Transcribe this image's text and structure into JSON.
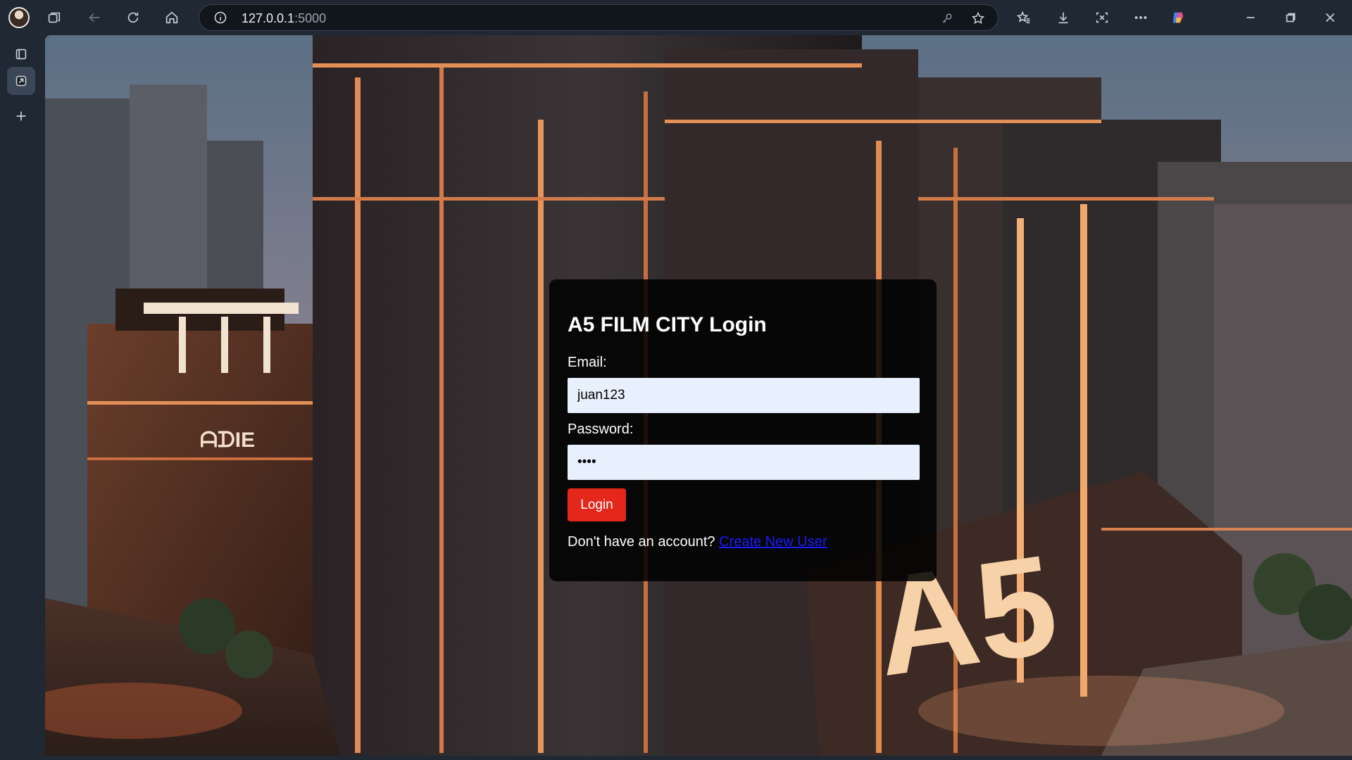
{
  "browser": {
    "url_host": "127.0.0.1",
    "url_port": ":5000",
    "icons": [
      "profile-avatar",
      "workspaces-icon",
      "back-icon",
      "refresh-icon",
      "home-icon",
      "info-icon",
      "key-icon",
      "star-icon",
      "favorites-icon",
      "download-icon",
      "screenshot-icon",
      "more-icon",
      "copilot-icon",
      "minimize-icon",
      "restore-icon",
      "close-icon"
    ],
    "sidebar_icons": [
      "tab-actions-icon",
      "active-tab-icon",
      "new-tab-icon"
    ]
  },
  "login": {
    "title": "A5 FILM CITY Login",
    "email_label": "Email:",
    "email_value": "juan123",
    "password_label": "Password:",
    "password_value": "••••",
    "login_button": "Login",
    "signup_prompt": "Don't have an account?",
    "signup_link": "Create New User"
  },
  "colors": {
    "login_button": "#e5261b",
    "link": "#1a1aff",
    "panel": "#000000"
  }
}
